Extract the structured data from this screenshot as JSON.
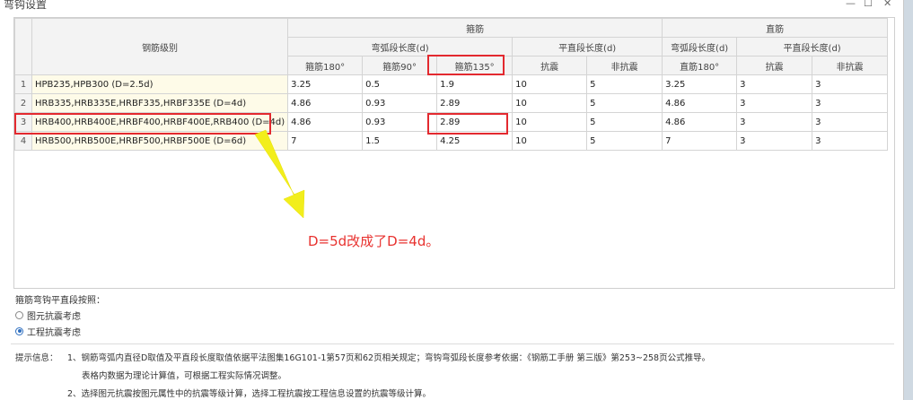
{
  "window": {
    "title": "弯钩设置",
    "minimize": "—",
    "maximize": "☐",
    "close": "✕"
  },
  "table": {
    "grade_header": "钢筋级别",
    "group_stirrup": "箍筋",
    "group_straight": "直筋",
    "sub_arc": "弯弧段长度(d)",
    "sub_flat": "平直段长度(d)",
    "columns": [
      "箍筋180°",
      "箍筋90°",
      "箍筋135°",
      "抗震",
      "非抗震",
      "直筋180°",
      "抗震",
      "非抗震"
    ],
    "rows": [
      {
        "no": "1",
        "grade": "HPB235,HPB300 (D=2.5d)",
        "values": [
          "3.25",
          "0.5",
          "1.9",
          "10",
          "5",
          "3.25",
          "3",
          "3"
        ]
      },
      {
        "no": "2",
        "grade": "HRB335,HRB335E,HRBF335,HRBF335E (D=4d)",
        "values": [
          "4.86",
          "0.93",
          "2.89",
          "10",
          "5",
          "4.86",
          "3",
          "3"
        ]
      },
      {
        "no": "3",
        "grade": "HRB400,HRB400E,HRBF400,HRBF400E,RRB400 (D=4d)",
        "values": [
          "4.86",
          "0.93",
          "2.89",
          "10",
          "5",
          "4.86",
          "3",
          "3"
        ]
      },
      {
        "no": "4",
        "grade": "HRB500,HRB500E,HRBF500,HRBF500E (D=6d)",
        "values": [
          "7",
          "1.5",
          "4.25",
          "10",
          "5",
          "7",
          "3",
          "3"
        ]
      }
    ]
  },
  "annotation": "D=5d改成了D=4d。",
  "options": {
    "label": "箍筋弯钩平直段按照：",
    "choices": [
      {
        "label": "图元抗震考虑",
        "checked": false
      },
      {
        "label": "工程抗震考虑",
        "checked": true
      }
    ]
  },
  "tips": {
    "heading": "提示信息：",
    "line1": "1、钢筋弯弧内直径D取值及平直段长度取值依据平法图集16G101-1第57页和62页相关规定；弯钩弯弧段长度参考依据：《钢筋工手册 第三版》第253~258页公式推导。",
    "line2": "表格内数据为理论计算值，可根据工程实际情况调整。",
    "line3": "2、选择图元抗震按图元属性中的抗震等级计算，选择工程抗震按工程信息设置的抗震等级计算。"
  },
  "colors": {
    "highlight": "#e3292f",
    "arrow": "#f2ee1c",
    "annotation": "#e8322f",
    "grade_cell": "#fefbe8"
  }
}
